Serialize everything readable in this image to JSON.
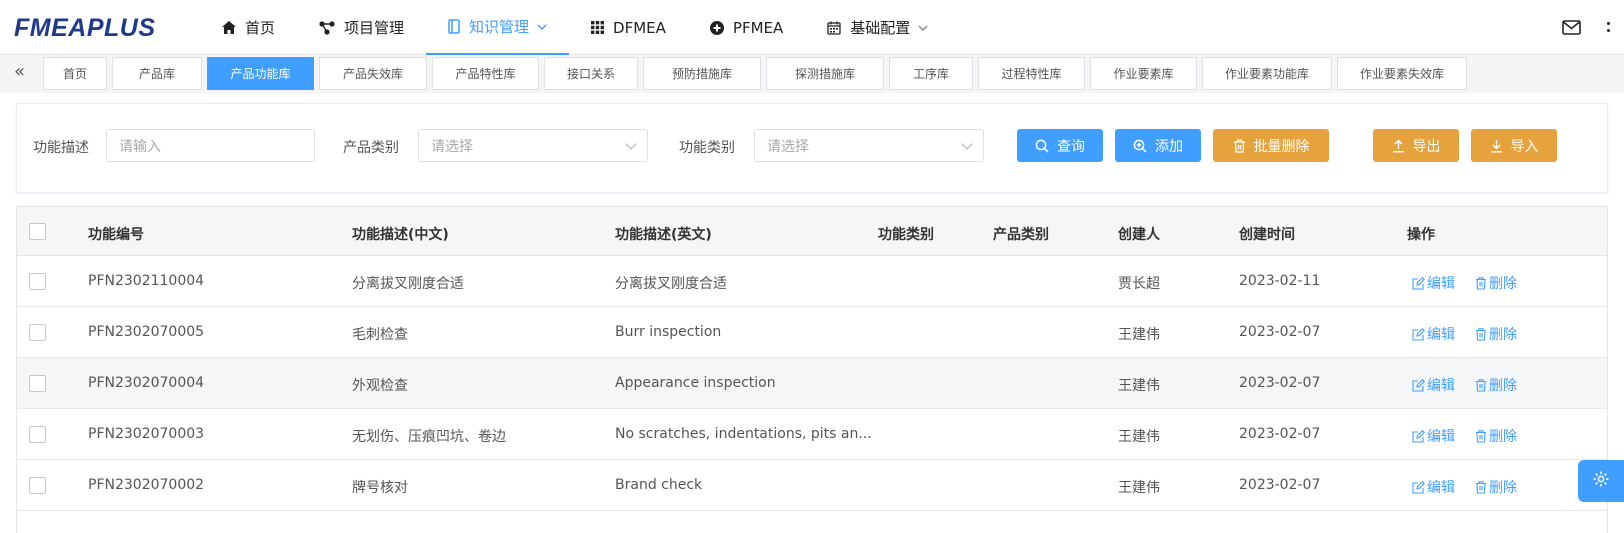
{
  "app": {
    "logo": "FMEAPLUS"
  },
  "nav": {
    "items": [
      {
        "label": "首页",
        "icon": "home-icon"
      },
      {
        "label": "项目管理",
        "icon": "project-tree-icon"
      },
      {
        "label": "知识管理",
        "icon": "book-icon",
        "active": true,
        "dropdown": true
      },
      {
        "label": "DFMEA",
        "icon": "grid-icon"
      },
      {
        "label": "PFMEA",
        "icon": "plus-circle-icon"
      },
      {
        "label": "基础配置",
        "icon": "calendar-icon",
        "dropdown": true
      }
    ]
  },
  "tabs": {
    "items": [
      "首页",
      "产品库",
      "产品功能库",
      "产品失效库",
      "产品特性库",
      "接口关系",
      "预防措施库",
      "探测措施库",
      "工序库",
      "过程特性库",
      "作业要素库",
      "作业要素功能库",
      "作业要素失效库"
    ],
    "active_index": 2
  },
  "search": {
    "desc_label": "功能描述",
    "desc_placeholder": "请输入",
    "product_type_label": "产品类别",
    "product_type_placeholder": "请选择",
    "func_type_label": "功能类别",
    "func_type_placeholder": "请选择",
    "query_btn": "查询",
    "add_btn": "添加",
    "batch_delete_btn": "批量删除",
    "export_btn": "导出",
    "import_btn": "导入"
  },
  "table": {
    "headers": {
      "code": "功能编号",
      "desc_cn": "功能描述(中文)",
      "desc_en": "功能描述(英文)",
      "func_type": "功能类别",
      "product_type": "产品类别",
      "creator": "创建人",
      "created": "创建时间",
      "ops": "操作"
    },
    "rows": [
      {
        "code": "PFN2302110004",
        "desc_cn": "分离拔叉刚度合适",
        "desc_en": "分离拔叉刚度合适",
        "func_type": "",
        "product_type": "",
        "creator": "贾长超",
        "created": "2023-02-11",
        "edit": "编辑",
        "delete": "删除"
      },
      {
        "code": "PFN2302070005",
        "desc_cn": "毛刺检查",
        "desc_en": "Burr inspection",
        "func_type": "",
        "product_type": "",
        "creator": "王建伟",
        "created": "2023-02-07",
        "edit": "编辑",
        "delete": "删除"
      },
      {
        "code": "PFN2302070004",
        "desc_cn": "外观检查",
        "desc_en": "Appearance inspection",
        "func_type": "",
        "product_type": "",
        "creator": "王建伟",
        "created": "2023-02-07",
        "edit": "编辑",
        "delete": "删除"
      },
      {
        "code": "PFN2302070003",
        "desc_cn": "无划伤、压痕凹坑、卷边",
        "desc_en": "No scratches, indentations, pits an...",
        "func_type": "",
        "product_type": "",
        "creator": "王建伟",
        "created": "2023-02-07",
        "edit": "编辑",
        "delete": "删除"
      },
      {
        "code": "PFN2302070002",
        "desc_cn": "牌号核对",
        "desc_en": "Brand check",
        "func_type": "",
        "product_type": "",
        "creator": "王建伟",
        "created": "2023-02-07",
        "edit": "编辑",
        "delete": "删除"
      }
    ]
  },
  "colors": {
    "primary": "#409eff",
    "warning": "#e6a23c",
    "logo": "#1f3a8a"
  }
}
